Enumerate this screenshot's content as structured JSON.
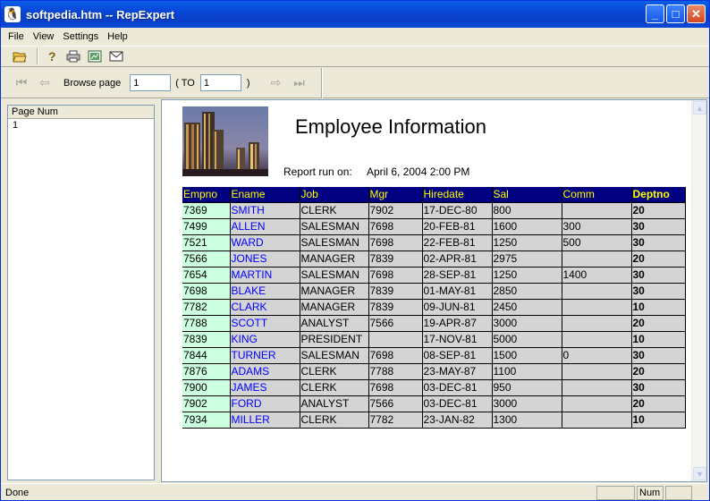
{
  "window": {
    "title": "softpedia.htm -- RepExpert"
  },
  "menu": [
    "File",
    "View",
    "Settings",
    "Help"
  ],
  "toolbar": {
    "browse_label": "Browse page",
    "from_value": "1",
    "to_label": "( TO",
    "to_value": "1",
    "close_paren": ")"
  },
  "left_pane": {
    "header": "Page Num",
    "items": [
      "1"
    ]
  },
  "report": {
    "title": "Employee Information",
    "run_label": "Report run on:",
    "run_value": "April 6, 2004 2:00 PM",
    "columns": [
      "Empno",
      "Ename",
      "Job",
      "Mgr",
      "Hiredate",
      "Sal",
      "Comm",
      "Deptno"
    ],
    "rows": [
      [
        "7369",
        "SMITH",
        "CLERK",
        "7902",
        "17-DEC-80",
        "800",
        "",
        "20"
      ],
      [
        "7499",
        "ALLEN",
        "SALESMAN",
        "7698",
        "20-FEB-81",
        "1600",
        "300",
        "30"
      ],
      [
        "7521",
        "WARD",
        "SALESMAN",
        "7698",
        "22-FEB-81",
        "1250",
        "500",
        "30"
      ],
      [
        "7566",
        "JONES",
        "MANAGER",
        "7839",
        "02-APR-81",
        "2975",
        "",
        "20"
      ],
      [
        "7654",
        "MARTIN",
        "SALESMAN",
        "7698",
        "28-SEP-81",
        "1250",
        "1400",
        "30"
      ],
      [
        "7698",
        "BLAKE",
        "MANAGER",
        "7839",
        "01-MAY-81",
        "2850",
        "",
        "30"
      ],
      [
        "7782",
        "CLARK",
        "MANAGER",
        "7839",
        "09-JUN-81",
        "2450",
        "",
        "10"
      ],
      [
        "7788",
        "SCOTT",
        "ANALYST",
        "7566",
        "19-APR-87",
        "3000",
        "",
        "20"
      ],
      [
        "7839",
        "KING",
        "PRESIDENT",
        "",
        "17-NOV-81",
        "5000",
        "",
        "10"
      ],
      [
        "7844",
        "TURNER",
        "SALESMAN",
        "7698",
        "08-SEP-81",
        "1500",
        "0",
        "30"
      ],
      [
        "7876",
        "ADAMS",
        "CLERK",
        "7788",
        "23-MAY-87",
        "1100",
        "",
        "20"
      ],
      [
        "7900",
        "JAMES",
        "CLERK",
        "7698",
        "03-DEC-81",
        "950",
        "",
        "30"
      ],
      [
        "7902",
        "FORD",
        "ANALYST",
        "7566",
        "03-DEC-81",
        "3000",
        "",
        "20"
      ],
      [
        "7934",
        "MILLER",
        "CLERK",
        "7782",
        "23-JAN-82",
        "1300",
        "",
        "10"
      ]
    ]
  },
  "status": {
    "text": "Done",
    "num": "Num"
  },
  "icons": {
    "app": "penguin-icon",
    "open": "folder-open-icon",
    "help": "question-icon",
    "print": "printer-icon",
    "export": "export-icon",
    "mail": "envelope-icon",
    "first": "first-page-icon",
    "prev": "prev-page-icon",
    "next": "next-page-icon",
    "last": "last-page-icon"
  },
  "colors": {
    "header_bg": "#000080",
    "header_text": "#ffff00",
    "name_link": "#0000ff",
    "empno_bg": "#ccffe0",
    "cell_bg": "#d4d4d4"
  }
}
